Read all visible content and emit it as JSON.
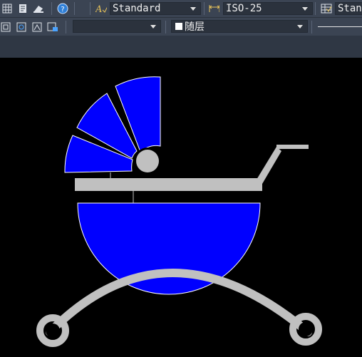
{
  "toolbar_top": {
    "text_style_value": "Standard",
    "dim_style_value": "ISO-25",
    "table_style_value": "Stan"
  },
  "toolbar_props": {
    "layer_value": "",
    "color_value": "随层"
  },
  "drawing": {
    "canopy_color": "#0000ff",
    "frame_color": "#c0c0c0",
    "background": "#000000"
  }
}
